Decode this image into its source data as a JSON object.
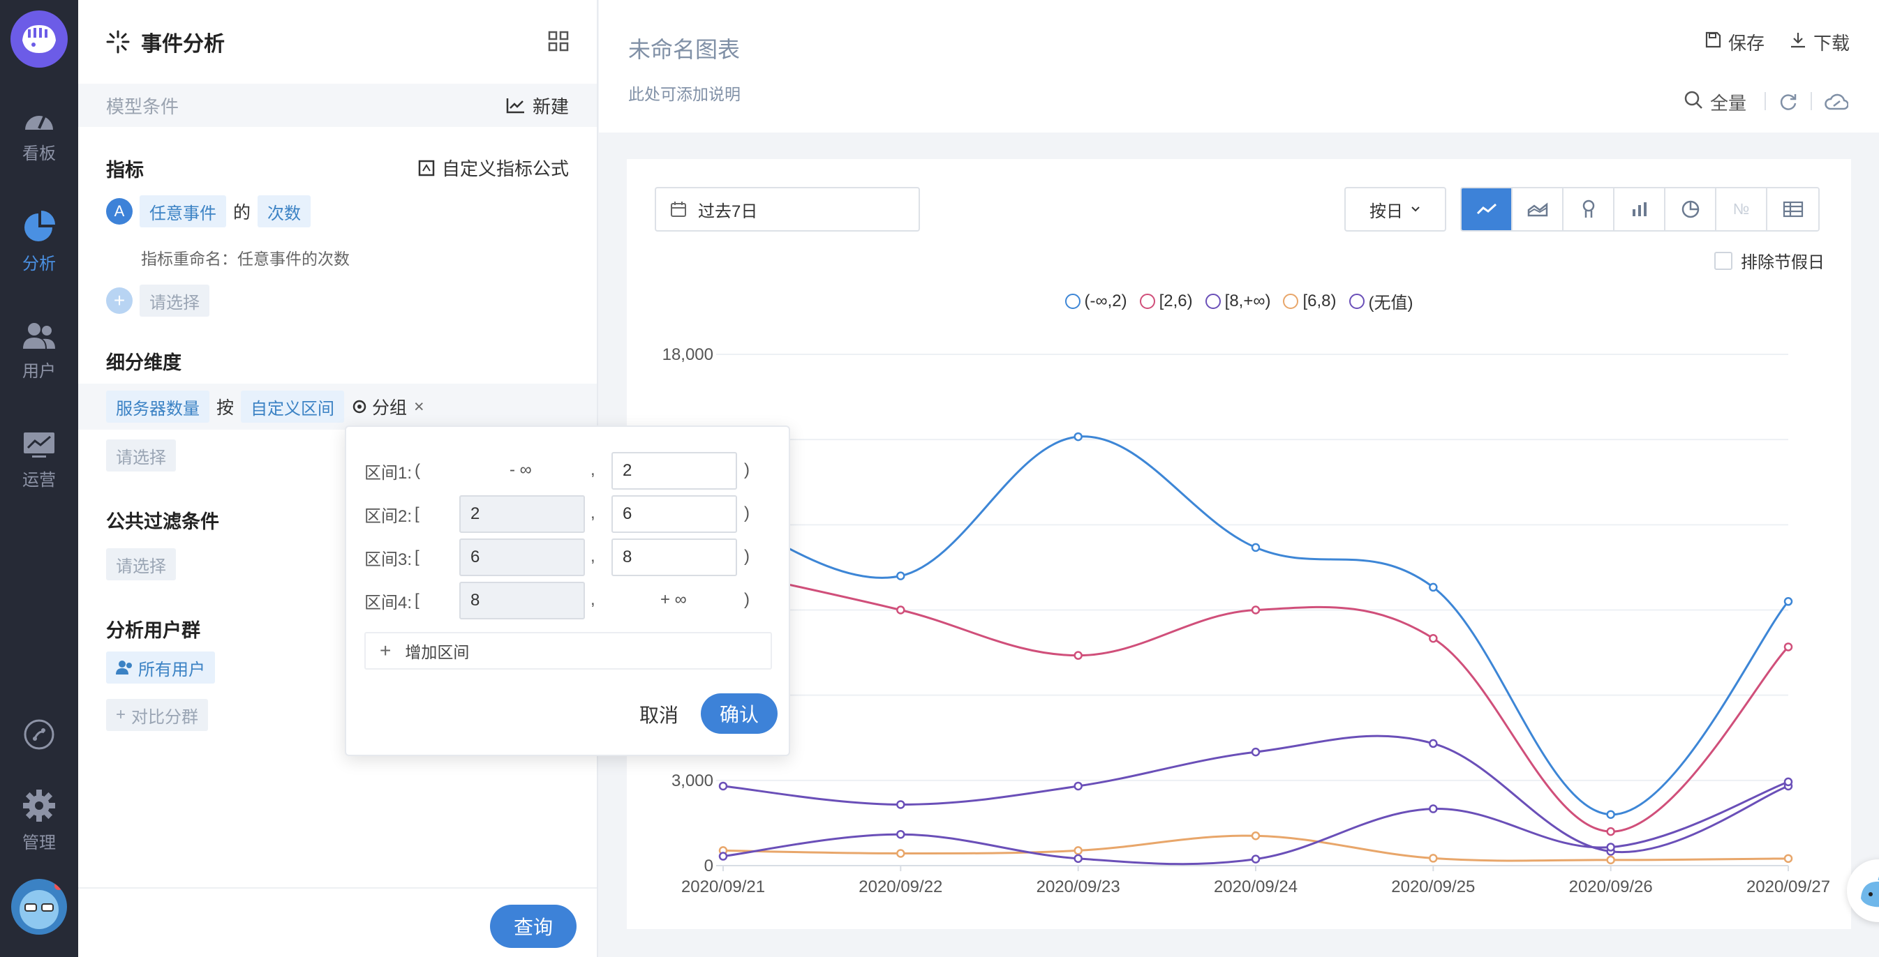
{
  "nav": {
    "items": [
      {
        "label": "看板",
        "icon": "dashboard-icon"
      },
      {
        "label": "分析",
        "icon": "pie-chart-icon",
        "active": true
      },
      {
        "label": "用户",
        "icon": "users-icon"
      },
      {
        "label": "运营",
        "icon": "operations-icon"
      },
      {
        "label": "管理",
        "icon": "gear-icon"
      }
    ]
  },
  "panel": {
    "title": "事件分析",
    "model_conditions": "模型条件",
    "new_label": "新建",
    "metrics": {
      "title": "指标",
      "custom_formula": "自定义指标公式",
      "badge": "A",
      "event": "任意事件",
      "of": "的",
      "measure": "次数",
      "rename": "指标重命名：任意事件的次数",
      "select": "请选择"
    },
    "breakdown": {
      "title": "细分维度",
      "dimension": "服务器数量",
      "by": "按",
      "mode": "自定义区间",
      "group": "分组",
      "close": "×",
      "select": "请选择"
    },
    "filter": {
      "title": "公共过滤条件",
      "select": "请选择"
    },
    "user_group": {
      "title": "分析用户群",
      "all_users": "所有用户",
      "compare": "对比分群"
    },
    "query": "查询"
  },
  "popover": {
    "ranges": [
      {
        "label": "区间1:",
        "open": "(",
        "lower": "- ∞",
        "upper": "2",
        "close": ")"
      },
      {
        "label": "区间2:",
        "open": "[",
        "lower": "2",
        "upper": "6",
        "close": ")"
      },
      {
        "label": "区间3:",
        "open": "[",
        "lower": "6",
        "upper": "8",
        "close": ")"
      },
      {
        "label": "区间4:",
        "open": "[",
        "lower": "8",
        "upper": "+ ∞",
        "close": ")"
      }
    ],
    "comma": ",",
    "add_range": "增加区间",
    "cancel": "取消",
    "confirm": "确认"
  },
  "header": {
    "title": "未命名图表",
    "description": "此处可添加说明",
    "save": "保存",
    "download": "下载",
    "full": "全量"
  },
  "toolbar": {
    "date_range": "过去7日",
    "granularity": "按日",
    "chart_types": [
      "line",
      "area",
      "funnel",
      "bar",
      "pie",
      "number",
      "table"
    ],
    "number_label": "№",
    "exclude_holidays": "排除节假日"
  },
  "chart_data": {
    "type": "line",
    "x": [
      "2020/09/21",
      "2020/09/22",
      "2020/09/23",
      "2020/09/24",
      "2020/09/25",
      "2020/09/26",
      "2020/09/27"
    ],
    "y_ticks": [
      0,
      3000,
      18000
    ],
    "ylim": [
      0,
      18000
    ],
    "series": [
      {
        "name": "(-∞,2)",
        "color": "#3d86d6",
        "values": [
          12400,
          10200,
          15100,
          11200,
          9800,
          1800,
          9300
        ]
      },
      {
        "name": "[2,6)",
        "color": "#d04f7a",
        "values": [
          10400,
          9000,
          7400,
          9000,
          8000,
          1200,
          7700
        ]
      },
      {
        "name": "[8,+∞)",
        "color": "#6a4fb8",
        "values": [
          2800,
          2150,
          2800,
          4000,
          4300,
          500,
          2800
        ]
      },
      {
        "name": "[6,8)",
        "color": "#e8a66a",
        "values": [
          530,
          430,
          530,
          1050,
          260,
          200,
          250
        ]
      },
      {
        "name": "(无值)",
        "color": "#6a4fb8",
        "values": [
          330,
          1100,
          250,
          230,
          2000,
          650,
          2950
        ]
      }
    ]
  }
}
